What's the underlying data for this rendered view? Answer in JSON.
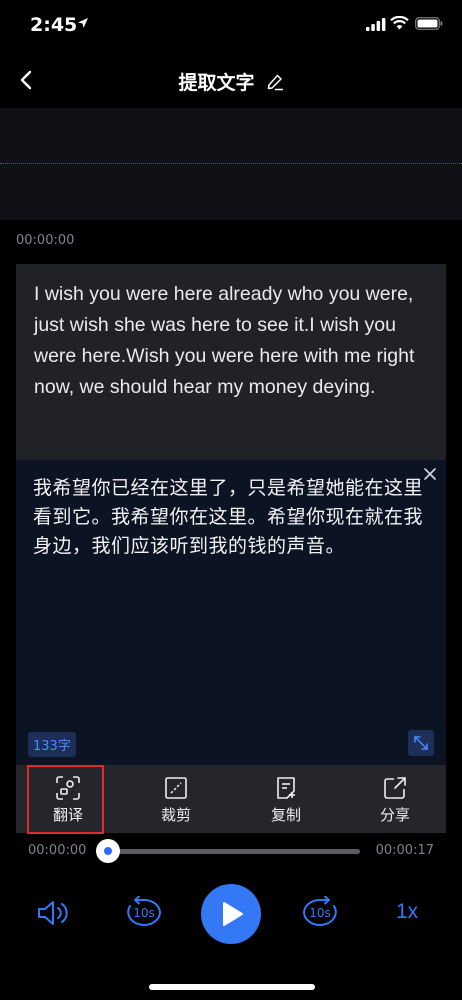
{
  "status_bar": {
    "time": "2:45"
  },
  "nav": {
    "title": "提取文字"
  },
  "waveform": {
    "time_marker": "00:00:00"
  },
  "original": {
    "text": "I wish you were here already who you were, just wish she was here to see it.I wish you were here.Wish you were here with me right now, we should hear my money deying."
  },
  "translation": {
    "text": "我希望你已经在这里了，只是希望她能在这里看到它。我希望你在这里。希望你现在就在我身边，我们应该听到我的钱的声音。",
    "char_count": "133字"
  },
  "toolbar": {
    "translate_label": "翻译",
    "crop_label": "裁剪",
    "copy_label": "复制",
    "share_label": "分享"
  },
  "playback": {
    "current_time": "00:00:00",
    "total_time": "00:00:17",
    "progress_fraction": 0,
    "rewind_label": "10s",
    "forward_label": "10s",
    "speed": "1x"
  },
  "colors": {
    "accent": "#3478f6",
    "highlight_border": "#e0282e",
    "translation_bg": "#0c1424"
  }
}
